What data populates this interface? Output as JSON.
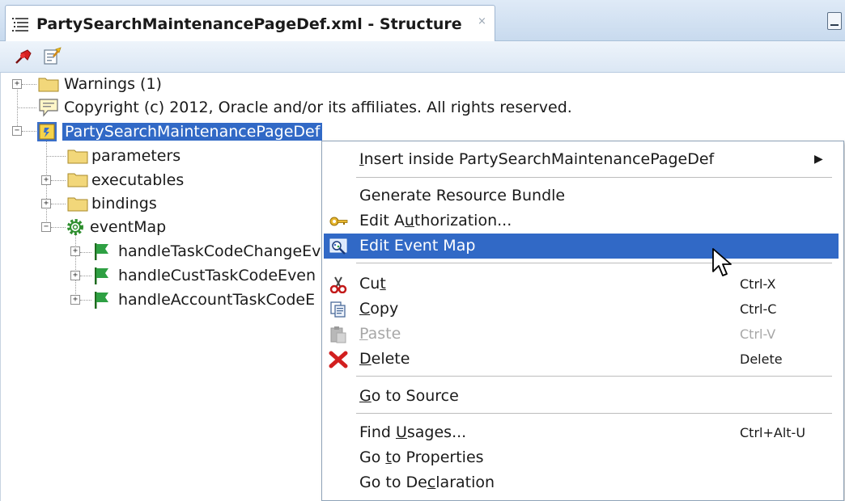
{
  "window": {
    "tab_title": "PartySearchMaintenancePageDef.xml - Structure",
    "tab_close": "×"
  },
  "toolbar": {
    "buttons": [
      {
        "name": "pin",
        "icon": "pin-icon"
      },
      {
        "name": "edit",
        "icon": "edit-document-icon"
      }
    ]
  },
  "tree": {
    "warnings": "Warnings (1)",
    "copyright": "Copyright (c) 2012, Oracle and/or its affiliates. All rights reserved.",
    "root": "PartySearchMaintenancePageDef",
    "parameters": "parameters",
    "executables": "executables",
    "bindings": "bindings",
    "eventMap": "eventMap",
    "events": [
      "handleTaskCodeChangeEv",
      "handleCustTaskCodeEven",
      "handleAccountTaskCodeE"
    ]
  },
  "context_menu": {
    "insert_inside": {
      "pre": "",
      "ul": "I",
      "post": "nsert inside PartySearchMaintenancePageDef"
    },
    "generate_bundle": "Generate Resource Bundle",
    "edit_authorization": {
      "pre": "Edit A",
      "ul": "u",
      "post": "thorization..."
    },
    "edit_event_map": "Edit Event Map",
    "cut": {
      "pre": "Cu",
      "ul": "t",
      "post": "",
      "shortcut": "Ctrl-X"
    },
    "copy": {
      "pre": "",
      "ul": "C",
      "post": "opy",
      "shortcut": "Ctrl-C"
    },
    "paste": {
      "pre": "",
      "ul": "P",
      "post": "aste",
      "shortcut": "Ctrl-V"
    },
    "delete": {
      "pre": "",
      "ul": "D",
      "post": "elete",
      "shortcut": "Delete"
    },
    "go_to_source": {
      "pre": "",
      "ul": "G",
      "post": "o to Source"
    },
    "find_usages": {
      "pre": "Find ",
      "ul": "U",
      "post": "sages...",
      "shortcut": "Ctrl+Alt-U"
    },
    "go_to_properties": {
      "pre": "Go ",
      "ul": "t",
      "post": "o Properties"
    },
    "go_to_declaration": {
      "pre": "Go to De",
      "ul": "c",
      "post": "laration"
    },
    "submenu_arrow": "▶"
  },
  "colors": {
    "selection": "#3169c6",
    "folder": "#f2d77a",
    "flag": "#2ea043"
  }
}
